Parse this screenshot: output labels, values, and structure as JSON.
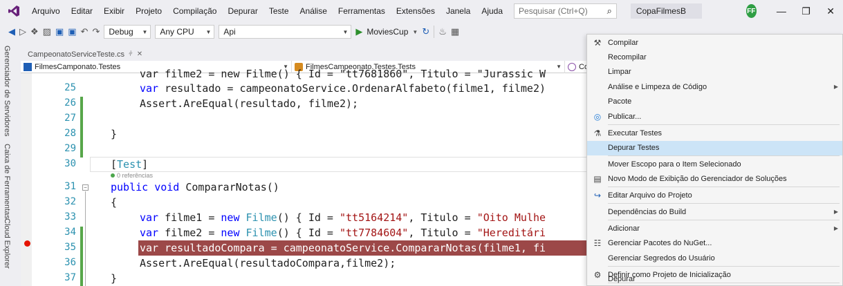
{
  "menubar": {
    "items": [
      "Arquivo",
      "Editar",
      "Exibir",
      "Projeto",
      "Compilação",
      "Depurar",
      "Teste",
      "Análise",
      "Ferramentas",
      "Extensões",
      "Janela",
      "Ajuda"
    ],
    "search_placeholder": "Pesquisar (Ctrl+Q)",
    "solution_name": "CopaFilmesB",
    "avatar_initials": "FF"
  },
  "toolbar": {
    "config": "Debug",
    "platform": "Any CPU",
    "project": "Api",
    "run_target": "MoviesCup"
  },
  "left_tabs": [
    "Gerenciador de Servidores",
    "Caixa de Ferramentas",
    "Cloud Explorer"
  ],
  "doc_tab": {
    "title": "CampeonatoServiceTeste.cs"
  },
  "navbar": {
    "project": "FilmesCamponato.Testes",
    "class": "FilmesCampeonato.Testes.Tests",
    "member": "Com"
  },
  "editor": {
    "line_numbers": [
      "25",
      "26",
      "27",
      "28",
      "29",
      "30",
      "31",
      "32",
      "33",
      "34",
      "35",
      "36",
      "37"
    ],
    "codelens": "0 referências",
    "partial_top": "var filme2 = new Filme() { Id = \"tt7681860\", Titulo = \"Jurassic W",
    "lines": {
      "l25": {
        "p1": "var ",
        "p2": "resultado = campeonatoService.OrdenarAlfabeto(filme1, filme2)"
      },
      "l26": "Assert.AreEqual(resultado, filme2);",
      "l28": "}",
      "l30": "[Test]",
      "l31": {
        "kw1": "public ",
        "kw2": "void ",
        "rest": "CompararNotas()"
      },
      "l32": "{",
      "l33": {
        "kw": "var ",
        "a": "filme1 = ",
        "kw2": "new ",
        "ty": "Filme",
        "b": "() { Id = ",
        "s1": "\"tt5164214\"",
        "c": ", Titulo = ",
        "s2": "\"Oito Mulhe"
      },
      "l34": {
        "kw": "var ",
        "a": "filme2 = ",
        "kw2": "new ",
        "ty": "Filme",
        "b": "() { Id = ",
        "s1": "\"tt7784604\"",
        "c": ", Titulo = ",
        "s2": "\"Hereditári"
      },
      "l35": "var resultadoCompara = campeonatoService.CompararNotas(filme1, fi",
      "l36": "Assert.AreEqual(resultadoCompara,filme2);",
      "l37": "}"
    }
  },
  "context_menu": {
    "items": [
      {
        "label": "Compilar",
        "icon": "build-icon"
      },
      {
        "label": "Recompilar"
      },
      {
        "label": "Limpar"
      },
      {
        "label": "Análise e Limpeza de Código",
        "submenu": true
      },
      {
        "label": "Pacote"
      },
      {
        "label": "Publicar...",
        "icon": "publish-icon"
      },
      {
        "label": "Executar Testes",
        "icon": "run-tests-icon"
      },
      {
        "label": "Depurar Testes",
        "highlighted": true
      },
      {
        "label": "Mover Escopo para o Item Selecionado"
      },
      {
        "label": "Novo Modo de Exibição do Gerenciador de Soluções",
        "icon": "new-view-icon"
      },
      {
        "label": "Editar Arquivo do Projeto",
        "icon": "edit-project-icon"
      },
      {
        "label": "Dependências do Build",
        "submenu": true
      },
      {
        "label": "Adicionar",
        "submenu": true
      },
      {
        "label": "Gerenciar Pacotes do NuGet...",
        "icon": "nuget-icon"
      },
      {
        "label": "Gerenciar Segredos do Usuário"
      },
      {
        "label": "Definir como Projeto de Inicialização",
        "icon": "gear-icon"
      },
      {
        "label": "Depurar",
        "submenu": true
      }
    ]
  },
  "colors": {
    "keyword": "#0000ff",
    "type": "#2b91af",
    "string": "#a31515",
    "breakpoint_line": "#9c4848",
    "menu_highlight": "#cce4f7"
  }
}
